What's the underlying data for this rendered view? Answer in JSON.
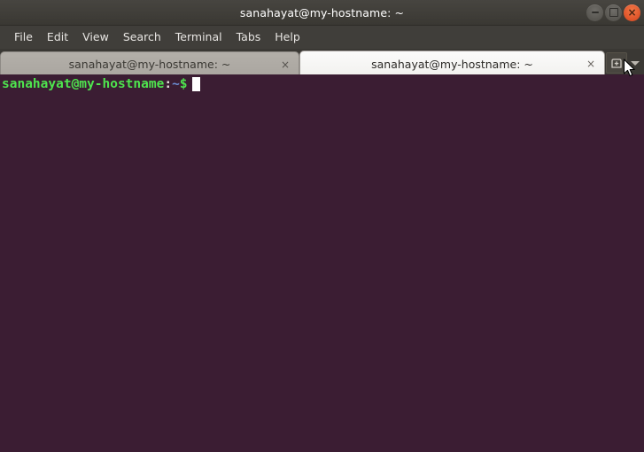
{
  "window": {
    "title": "sanahayat@my-hostname: ~",
    "controls": [
      {
        "name": "minimize",
        "glyph": "–"
      },
      {
        "name": "maximize",
        "glyph": "□"
      },
      {
        "name": "close",
        "glyph": "×"
      }
    ]
  },
  "menubar": {
    "items": [
      {
        "label": "File"
      },
      {
        "label": "Edit"
      },
      {
        "label": "View"
      },
      {
        "label": "Search"
      },
      {
        "label": "Terminal"
      },
      {
        "label": "Tabs"
      },
      {
        "label": "Help"
      }
    ]
  },
  "tabbar": {
    "tabs": [
      {
        "label": "sanahayat@my-hostname: ~",
        "close_glyph": "×",
        "active": false
      },
      {
        "label": "sanahayat@my-hostname: ~",
        "close_glyph": "×",
        "active": true
      }
    ],
    "new_tab_icon": "new-tab-icon",
    "tab_list_icon": "chevron-down-icon"
  },
  "terminal": {
    "background_color": "#3b1d33",
    "prompt": {
      "user_host": "sanahayat@my-hostname",
      "separator": ":",
      "path": "~",
      "symbol": "$",
      "command": ""
    },
    "cursor": "block"
  },
  "colors": {
    "titlebar": "#403e39",
    "menubar": "#403e3a",
    "tab_active": "#f7f6f4",
    "tab_inactive": "#aeaaa4",
    "terminal_bg": "#3b1d33",
    "prompt_green": "#4ee44e",
    "prompt_blue": "#6c8fd6",
    "close_button": "#e2572c"
  }
}
